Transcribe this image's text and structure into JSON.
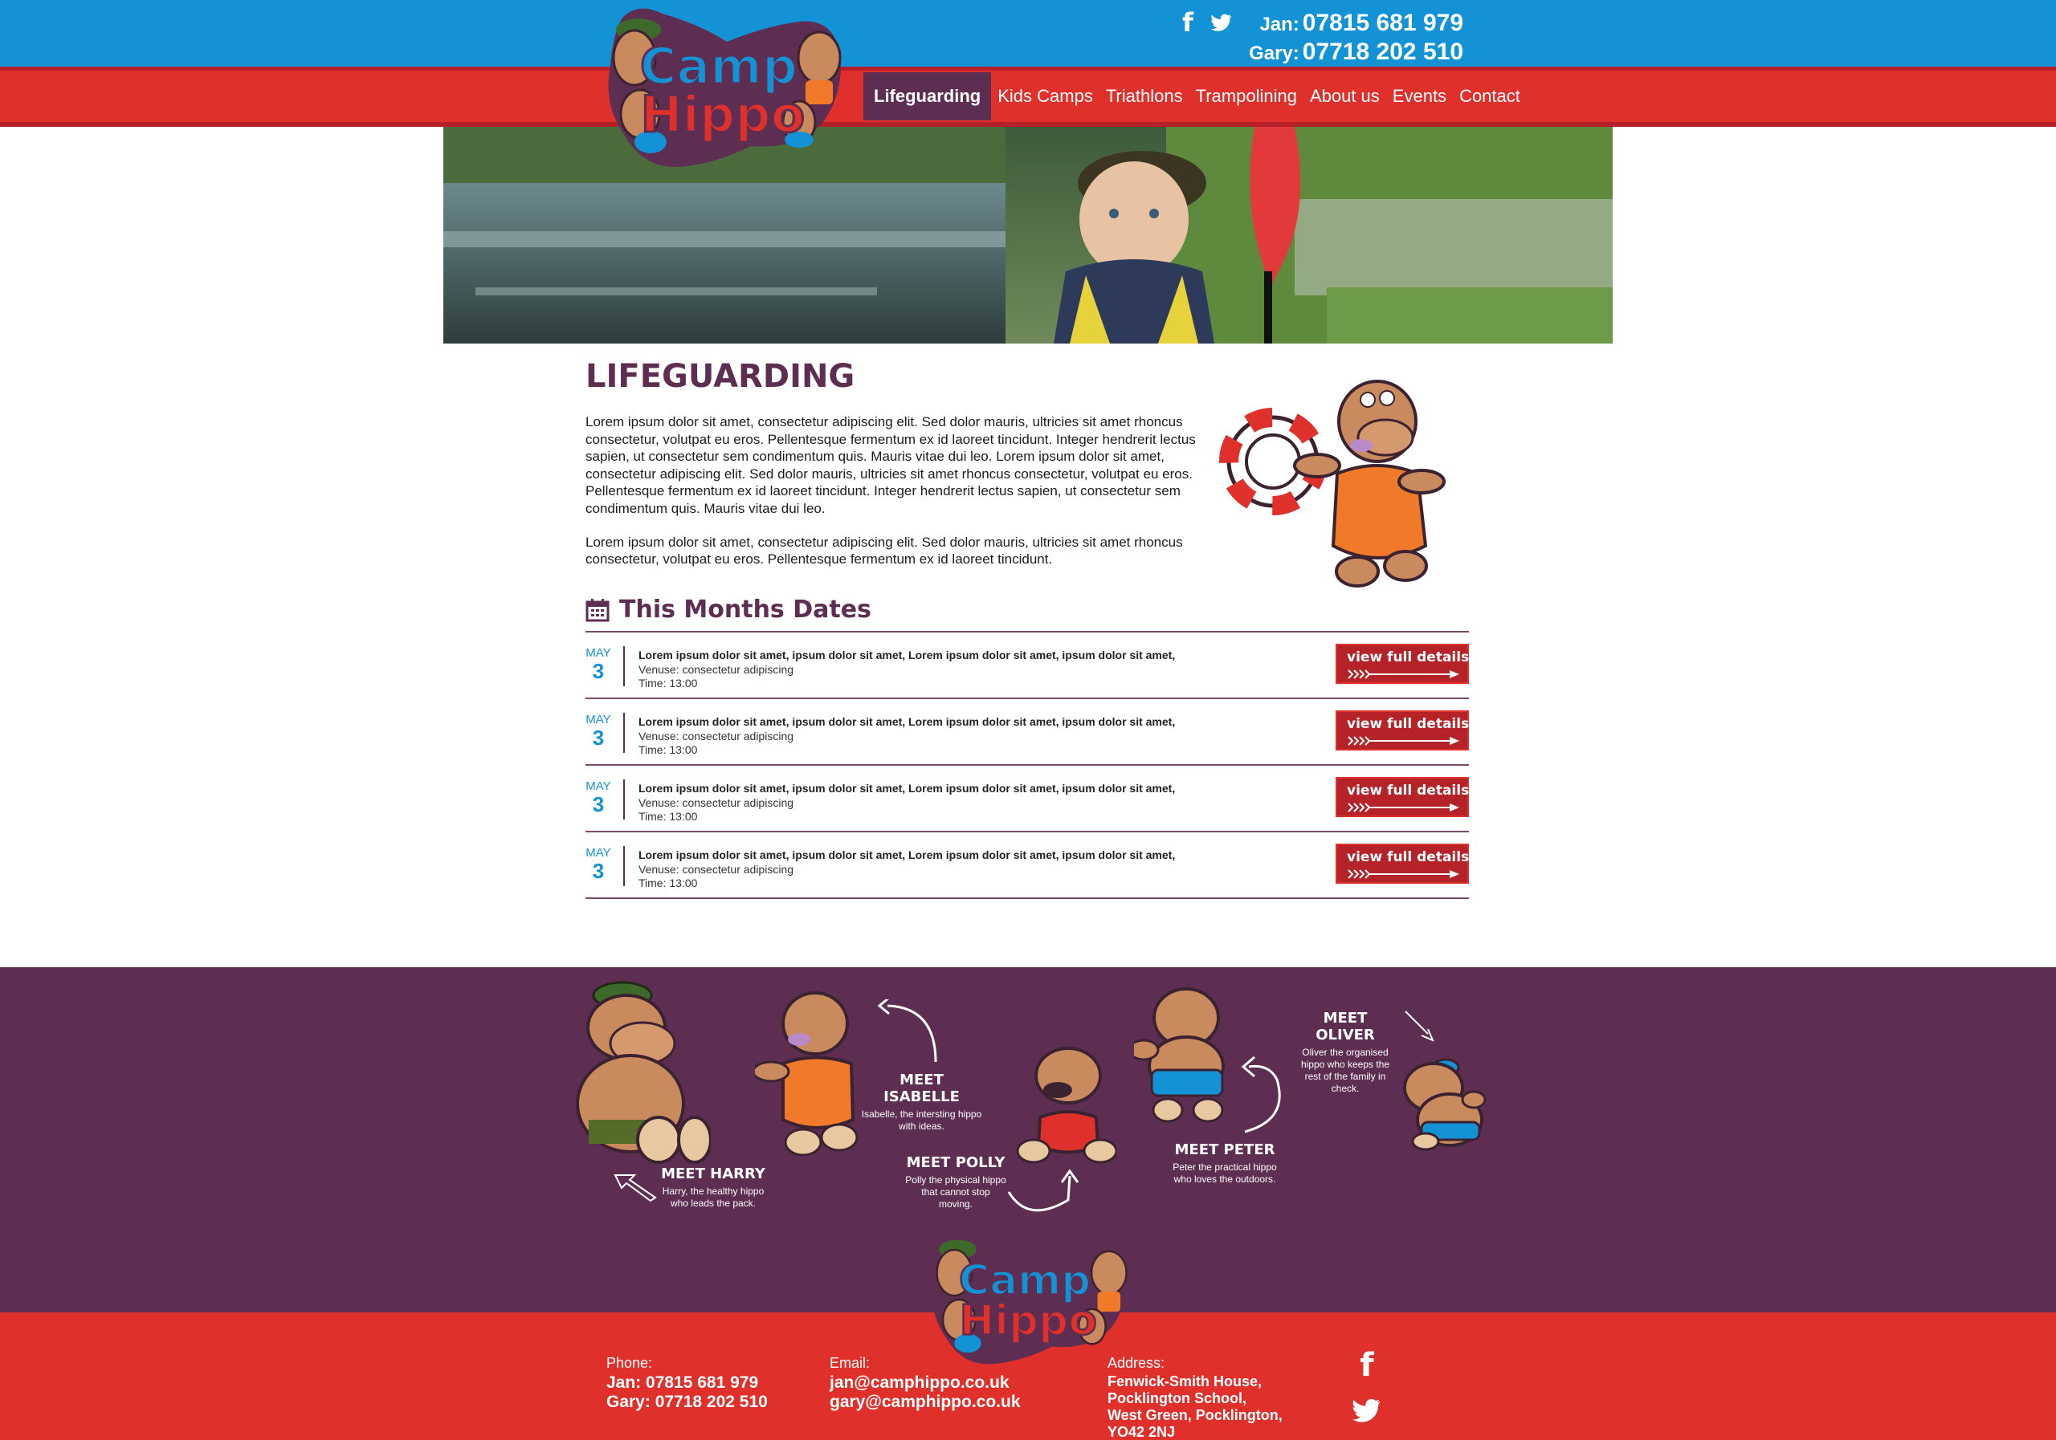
{
  "header": {
    "social": [
      "facebook-icon",
      "twitter-icon"
    ],
    "phones": [
      {
        "label": "Jan:",
        "number": "07815 681 979"
      },
      {
        "label": "Gary:",
        "number": "07718 202 510"
      }
    ],
    "logo_text_1": "Camp",
    "logo_text_2": "Hippo"
  },
  "nav": {
    "items": [
      "Lifeguarding",
      "Kids Camps",
      "Triathlons",
      "Trampolining",
      "About us",
      "Events",
      "Contact"
    ],
    "active": "Lifeguarding"
  },
  "content": {
    "title": "LIFEGUARDING",
    "paragraphs": [
      "Lorem ipsum dolor sit amet, consectetur adipiscing elit. Sed dolor mauris, ultricies sit amet rhoncus consectetur, volutpat eu eros. Pellentesque fermentum ex id laoreet tincidunt. Integer hendrerit lectus sapien, ut consectetur sem condimentum quis. Mauris vitae dui leo. Lorem ipsum dolor sit amet, consectetur adipiscing elit. Sed dolor mauris, ultricies sit amet rhoncus consectetur, volutpat eu eros. Pellentesque fermentum ex id laoreet tincidunt. Integer hendrerit lectus sapien, ut consectetur sem condimentum quis. Mauris vitae dui leo.",
      "Lorem ipsum dolor sit amet, consectetur adipiscing elit. Sed dolor mauris, ultricies sit amet rhoncus consectetur, volutpat eu eros. Pellentesque fermentum ex id laoreet tincidunt."
    ]
  },
  "dates": {
    "heading": "This Months Dates",
    "events": [
      {
        "month": "MAY",
        "day": "3",
        "title": "Lorem ipsum dolor sit amet, ipsum dolor sit amet, Lorem ipsum dolor sit amet, ipsum dolor sit amet,",
        "venue": "Venuse: consectetur adipiscing",
        "time": "Time: 13:00",
        "button": "view full details"
      },
      {
        "month": "MAY",
        "day": "3",
        "title": "Lorem ipsum dolor sit amet, ipsum dolor sit amet, Lorem ipsum dolor sit amet, ipsum dolor sit amet,",
        "venue": "Venuse: consectetur adipiscing",
        "time": "Time: 13:00",
        "button": "view full details"
      },
      {
        "month": "MAY",
        "day": "3",
        "title": "Lorem ipsum dolor sit amet, ipsum dolor sit amet, Lorem ipsum dolor sit amet, ipsum dolor sit amet,",
        "venue": "Venuse: consectetur adipiscing",
        "time": "Time: 13:00",
        "button": "view full details"
      },
      {
        "month": "MAY",
        "day": "3",
        "title": "Lorem ipsum dolor sit amet, ipsum dolor sit amet, Lorem ipsum dolor sit amet, ipsum dolor sit amet,",
        "venue": "Venuse: consectetur adipiscing",
        "time": "Time: 13:00",
        "button": "view full details"
      }
    ]
  },
  "meet": {
    "harry": {
      "name": "MEET HARRY",
      "desc": "Harry, the healthy hippo who leads the pack."
    },
    "isabelle": {
      "name": "MEET ISABELLE",
      "desc": "Isabelle, the intersting hippo with ideas."
    },
    "polly": {
      "name": "MEET POLLY",
      "desc": "Polly the physical hippo that cannot stop moving."
    },
    "peter": {
      "name": "MEET PETER",
      "desc": "Peter the practical hippo who loves the outdoors."
    },
    "oliver": {
      "name": "MEET OLIVER",
      "desc": "Oliver the organised hippo who keeps the rest of the family in check."
    }
  },
  "footer": {
    "phone_label": "Phone:",
    "phone_jan": "Jan: 07815 681 979",
    "phone_gary": "Gary: 07718 202 510",
    "email_label": "Email:",
    "email_jan": "jan@camphippo.co.uk",
    "email_gary": "gary@camphippo.co.uk",
    "address_label": "Address:",
    "address_lines": [
      "Fenwick-Smith House,",
      "Pocklington School,",
      "West Green, Pocklington,",
      "YO42 2NJ"
    ]
  },
  "colors": {
    "blue": "#1393d6",
    "red": "#e0302b",
    "purple": "#5e2e52",
    "dark_red": "#b52328"
  }
}
